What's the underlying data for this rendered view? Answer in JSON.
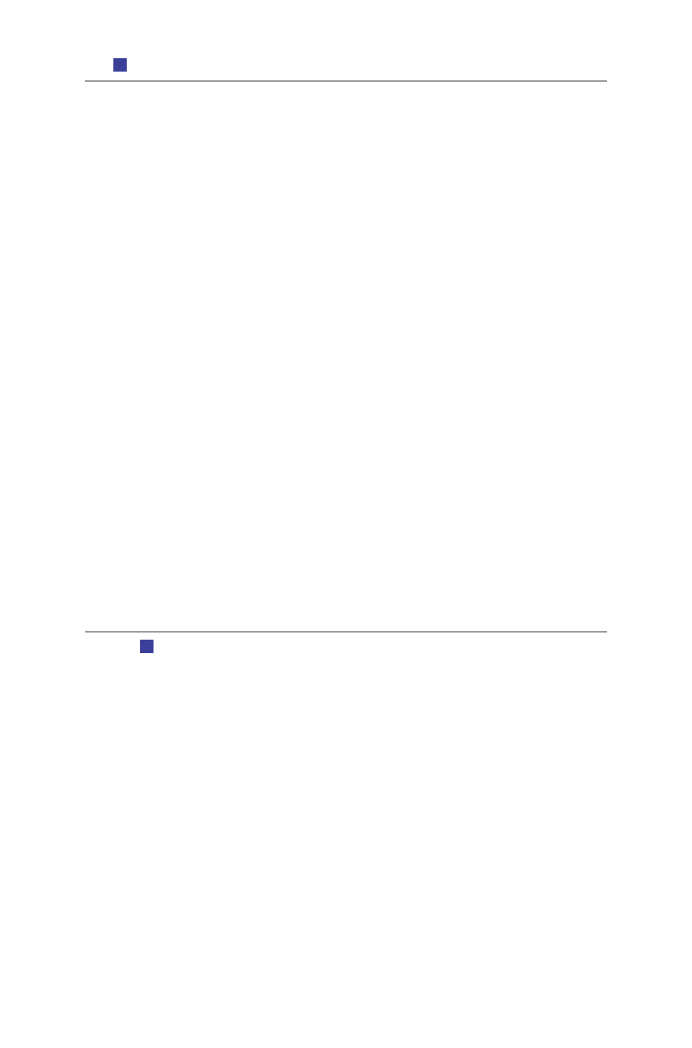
{
  "header": {
    "marker_color": "#3b3f9a",
    "marker_icon": "square-marker-icon"
  },
  "footer": {
    "marker_color": "#3b3f9a",
    "marker_icon": "square-marker-icon"
  },
  "rule_color": "#9a9a9a"
}
